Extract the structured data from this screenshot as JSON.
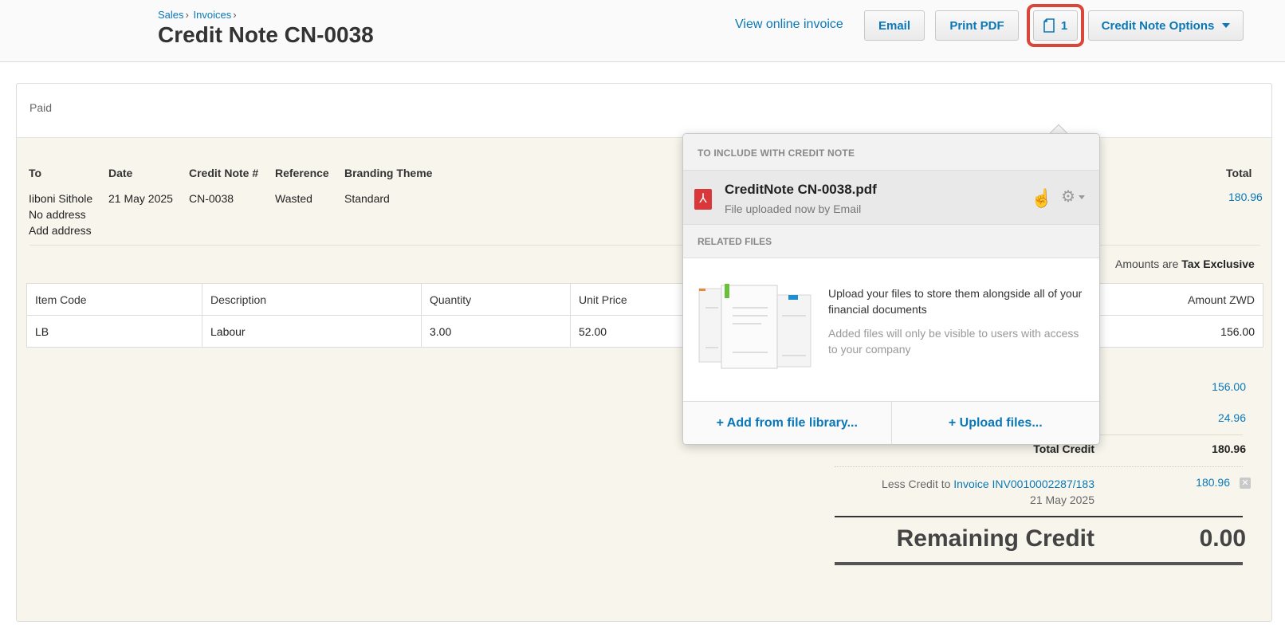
{
  "header": {
    "breadcrumb": [
      "Sales",
      "Invoices"
    ],
    "title": "Credit Note CN-0038"
  },
  "toolbar": {
    "status": "Paid",
    "view_online": "View online invoice",
    "email": "Email",
    "print_pdf": "Print PDF",
    "files_count": "1",
    "options": "Credit Note Options"
  },
  "details": {
    "to_label": "To",
    "to_name": "Iiboni Sithole",
    "address": "No address",
    "add_address": "Add address",
    "date_label": "Date",
    "date": "21 May 2025",
    "number_label": "Credit Note #",
    "number": "CN-0038",
    "reference_label": "Reference",
    "reference": "Wasted",
    "theme_label": "Branding Theme",
    "theme": "Standard",
    "total_label": "Total",
    "total": "180.96"
  },
  "amounts_note": {
    "prefix": "Amounts are",
    "mode": "Tax Exclusive"
  },
  "table": {
    "headers": [
      "Item Code",
      "Description",
      "Quantity",
      "Unit Price",
      "Amount ZWD"
    ],
    "rows": [
      {
        "code": "LB",
        "description": "Labour",
        "quantity": "3.00",
        "unit_price": "52.00",
        "amount": "156.00"
      }
    ]
  },
  "summary": {
    "subtotal": "156.00",
    "tax": "24.96",
    "total_credit_label": "Total Credit",
    "total_credit": "180.96",
    "less_credit_prefix": "Less Credit to",
    "less_credit_link": "Invoice",
    "less_credit_invoice": "INV0010002287/183",
    "less_credit_date": "21 May 2025",
    "less_credit_amount": "180.96",
    "remaining_label": "Remaining Credit",
    "remaining": "0.00"
  },
  "popover": {
    "include_heading": "TO INCLUDE WITH CREDIT NOTE",
    "file_name": "CreditNote CN-0038.pdf",
    "file_sub": "File uploaded now by Email",
    "related_heading": "RELATED FILES",
    "upload_main": "Upload your files to store them alongside all of your financial documents",
    "upload_sub": "Added files will only be visible to users with access to your company",
    "add_library": "+ Add from file library...",
    "upload_files": "+ Upload files..."
  },
  "colors": {
    "accent": "#0a78b8",
    "highlight": "#d9473b",
    "panel": "#f8f6ec"
  }
}
